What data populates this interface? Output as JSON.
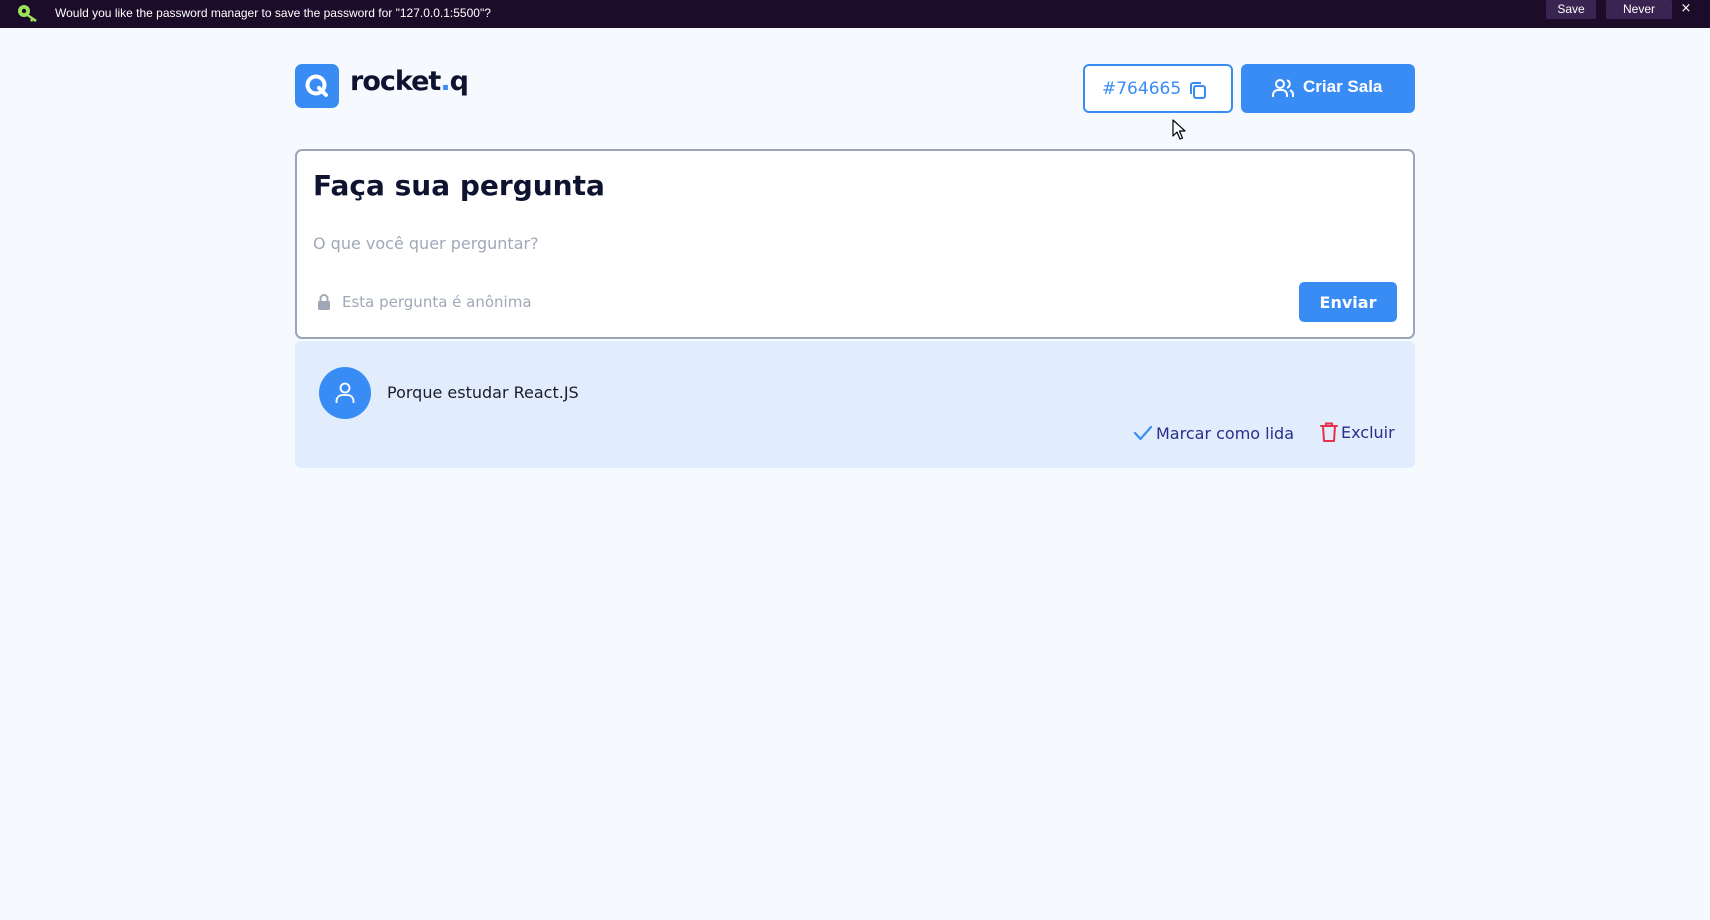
{
  "password_bar": {
    "message": "Would you like the password manager to save the password for \"127.0.0.1:5500\"?",
    "save_label": "Save",
    "never_label": "Never",
    "close_label": "×",
    "icon": "key-icon"
  },
  "header": {
    "logo_main": "rocket",
    "logo_dot": ".",
    "logo_end": "q",
    "room_code": "#764665",
    "create_room_label": "Criar Sala"
  },
  "form": {
    "title": "Faça sua pergunta",
    "question_placeholder": "O que você quer perguntar?",
    "question_value": "",
    "anonymous_label": "Esta pergunta é anônima",
    "send_label": "Enviar"
  },
  "questions": [
    {
      "text": "Porque estudar React.JS",
      "mark_read_label": "Marcar como lida",
      "delete_label": "Excluir"
    }
  ],
  "colors": {
    "accent": "#3a8cf5",
    "background": "#f6faff",
    "question_bg": "#e1edfd",
    "title": "#0e1430",
    "delete_icon": "#e8304f",
    "pm_bar": "#1c0c2a"
  }
}
